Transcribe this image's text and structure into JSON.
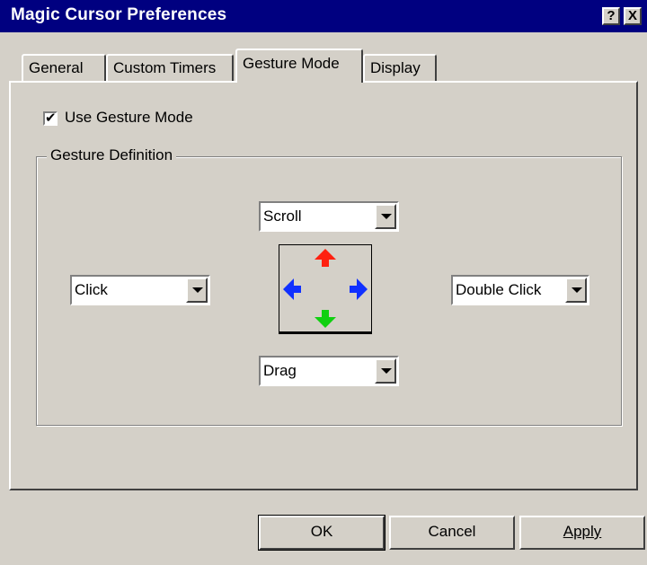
{
  "window": {
    "title": "Magic Cursor Preferences",
    "help_button": "?",
    "close_button": "X"
  },
  "tabs": [
    {
      "label": "General",
      "active": false
    },
    {
      "label": "Custom Timers",
      "active": false
    },
    {
      "label": "Gesture Mode",
      "active": true
    },
    {
      "label": "Display",
      "active": false
    }
  ],
  "gesture_mode": {
    "use_gesture_mode": {
      "label": "Use Gesture Mode",
      "checked": true,
      "check_mark": "✔"
    },
    "group_title": "Gesture Definition",
    "up": {
      "value": "Scroll"
    },
    "left": {
      "value": "Click"
    },
    "right": {
      "value": "Double Click"
    },
    "down": {
      "value": "Drag"
    },
    "preview_arrows": {
      "up": {
        "icon": "arrow-up-icon",
        "color": "#ff2010"
      },
      "left": {
        "icon": "arrow-left-icon",
        "color": "#1030ff"
      },
      "right": {
        "icon": "arrow-right-icon",
        "color": "#1030ff"
      },
      "down": {
        "icon": "arrow-down-icon",
        "color": "#10d010"
      }
    }
  },
  "buttons": {
    "ok": "OK",
    "cancel": "Cancel",
    "apply": "Apply"
  }
}
